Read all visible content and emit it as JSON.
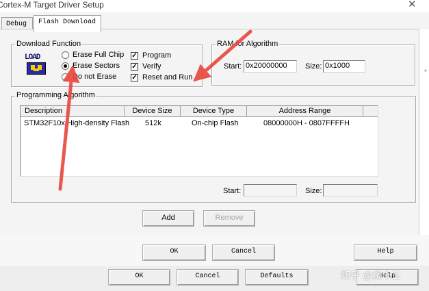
{
  "window": {
    "title": "Cortex-M Target Driver Setup"
  },
  "tabs": [
    {
      "label": "Debug"
    },
    {
      "label": "Flash Download"
    }
  ],
  "download_function": {
    "legend": "Download Function",
    "logo_text": "LOAD",
    "radios": [
      {
        "label": "Erase Full Chip",
        "checked": false
      },
      {
        "label": "Erase Sectors",
        "checked": true
      },
      {
        "label": "Do not Erase",
        "checked": false
      }
    ],
    "checks": [
      {
        "label": "Program",
        "checked": true
      },
      {
        "label": "Verify",
        "checked": true
      },
      {
        "label": "Reset and Run",
        "checked": true
      }
    ]
  },
  "ram": {
    "legend": "RAM for Algorithm",
    "start_label": "Start:",
    "start_value": "0x20000000",
    "size_label": "Size:",
    "size_value": "0x1000"
  },
  "programming_algorithm": {
    "legend": "Programming Algorithm",
    "columns": [
      "Description",
      "Device Size",
      "Device Type",
      "Address Range"
    ],
    "rows": [
      {
        "description": "STM32F10x High-density Flash",
        "device_size": "512k",
        "device_type": "On-chip Flash",
        "address_range": "08000000H - 0807FFFFH"
      }
    ],
    "start_label": "Start:",
    "size_label": "Size:",
    "add_label": "Add",
    "remove_label": "Remove"
  },
  "dialog_buttons": {
    "ok": "OK",
    "cancel": "Cancel",
    "help": "Help"
  },
  "back_buttons": {
    "ok": "OK",
    "cancel": "Cancel",
    "defaults": "Defaults",
    "help": "Help"
  },
  "watermark": "知乎 @烧十三",
  "annotations": {
    "arrow_color": "#e8453c"
  }
}
